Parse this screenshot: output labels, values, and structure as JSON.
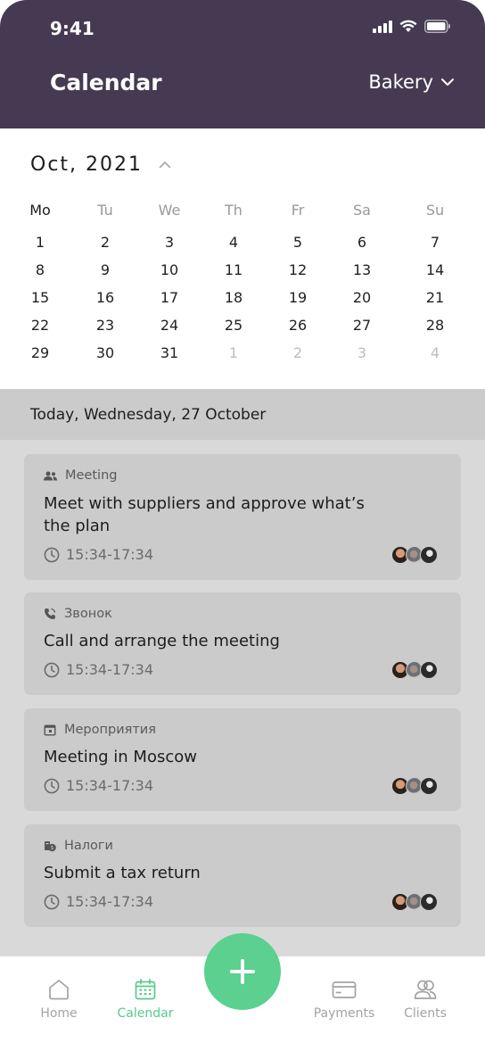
{
  "status_bar": {
    "time": "9:41"
  },
  "header": {
    "title": "Calendar",
    "dropdown_label": "Bakery"
  },
  "calendar": {
    "month_label": "Oct, 2021",
    "weekdays": [
      "Mo",
      "Tu",
      "We",
      "Th",
      "Fr",
      "Sa",
      "Su"
    ],
    "weeks": [
      [
        "1",
        "2",
        "3",
        "4",
        "5",
        "6",
        "7"
      ],
      [
        "8",
        "9",
        "10",
        "11",
        "12",
        "13",
        "14"
      ],
      [
        "15",
        "16",
        "17",
        "18",
        "19",
        "20",
        "21"
      ],
      [
        "22",
        "23",
        "24",
        "25",
        "26",
        "27",
        "28"
      ],
      [
        "29",
        "30",
        "31",
        "1",
        "2",
        "3",
        "4"
      ]
    ]
  },
  "today_label": "Today, Wednesday, 27 October",
  "events": [
    {
      "category": "Meeting",
      "category_icon": "people-icon",
      "title": "Meet with suppliers and approve what’s the plan",
      "time": "15:34-17:34"
    },
    {
      "category": "Звонок",
      "category_icon": "phone-icon",
      "title": "Call and arrange the meeting",
      "time": "15:34-17:34"
    },
    {
      "category": "Мероприятия",
      "category_icon": "calendar-event-icon",
      "title": "Meeting in Moscow",
      "time": "15:34-17:34"
    },
    {
      "category": "Налоги",
      "category_icon": "money-icon",
      "title": "Submit a tax return",
      "time": "15:34-17:34"
    }
  ],
  "nav": {
    "items": [
      {
        "label": "Home",
        "icon": "home-icon"
      },
      {
        "label": "Calendar",
        "icon": "calendar-icon"
      },
      {
        "label": "Payments",
        "icon": "card-icon"
      },
      {
        "label": "Clients",
        "icon": "users-icon"
      }
    ],
    "fab_icon": "plus-icon"
  },
  "colors": {
    "header_bg": "#453a52",
    "accent": "#57c98d",
    "card_bg": "#cbcbcb"
  }
}
